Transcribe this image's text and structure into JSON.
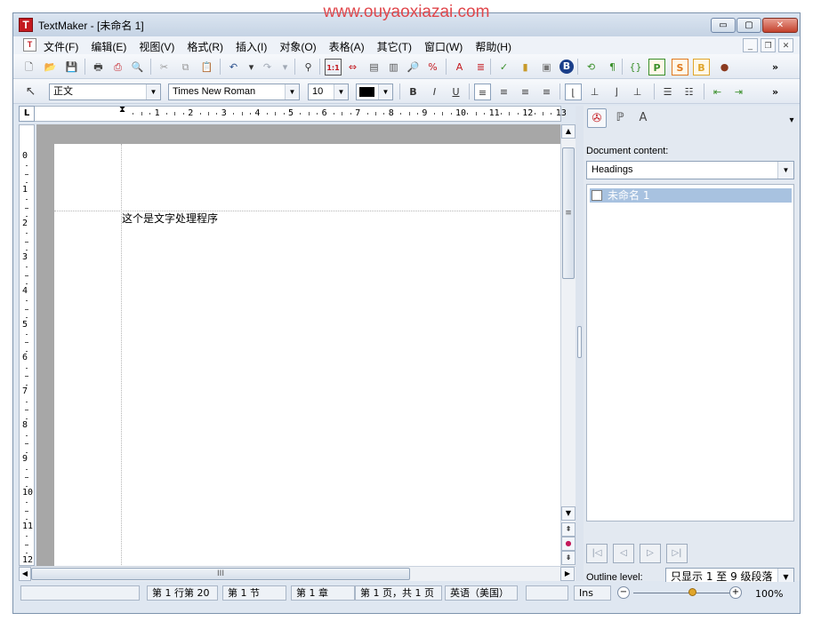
{
  "watermark": "www.ouyaoxiazai.com",
  "window": {
    "title": "TextMaker - [未命名 1]",
    "app_icon": "T",
    "controls": {
      "minimize": "▭",
      "maximize": "▢",
      "close": "✕"
    }
  },
  "menu": {
    "doc_icon": "T",
    "items": [
      "文件(F)",
      "编辑(E)",
      "视图(V)",
      "格式(R)",
      "插入(I)",
      "对象(O)",
      "表格(A)",
      "其它(T)",
      "窗口(W)",
      "帮助(H)"
    ],
    "mdi": {
      "minimize": "_",
      "restore": "❐",
      "close": "✕"
    }
  },
  "toolbar_standard": {
    "icons": [
      {
        "name": "new-document-icon",
        "glyph": "🗋",
        "color": "#555555"
      },
      {
        "name": "open-folder-icon",
        "glyph": "📂",
        "color": "#d8a12a"
      },
      {
        "name": "save-icon",
        "glyph": "💾",
        "color": "#2f5f9c"
      },
      {
        "name": "print-icon",
        "glyph": "🖶",
        "color": "#444444"
      },
      {
        "name": "export-pdf-icon",
        "glyph": "⎙",
        "color": "#c4191f"
      },
      {
        "name": "print-preview-icon",
        "glyph": "🔍",
        "color": "#555555"
      },
      {
        "name": "cut-icon",
        "glyph": "✂",
        "color": "#999999"
      },
      {
        "name": "copy-icon",
        "glyph": "⧉",
        "color": "#999999"
      },
      {
        "name": "paste-icon",
        "glyph": "📋",
        "color": "#7a5a2a"
      },
      {
        "name": "undo-icon",
        "glyph": "↶",
        "color": "#2a4f8c"
      },
      {
        "name": "undo-dropdown-icon",
        "glyph": "▾",
        "color": "#333333"
      },
      {
        "name": "redo-icon",
        "glyph": "↷",
        "color": "#a0a8b4"
      },
      {
        "name": "redo-dropdown-icon",
        "glyph": "▾",
        "color": "#a0a8b4"
      },
      {
        "name": "find-binoculars-icon",
        "glyph": "⚲",
        "color": "#333333"
      },
      {
        "name": "normal-view-icon",
        "glyph": "1:1",
        "color": "#c4191f"
      },
      {
        "name": "page-width-icon",
        "glyph": "⇔",
        "color": "#c4191f"
      },
      {
        "name": "full-page-icon",
        "glyph": "▤",
        "color": "#555555"
      },
      {
        "name": "two-pages-icon",
        "glyph": "▥",
        "color": "#555555"
      },
      {
        "name": "zoom-icon",
        "glyph": "🔎",
        "color": "#333333"
      },
      {
        "name": "zoom-percent-icon",
        "glyph": "%",
        "color": "#c4191f"
      },
      {
        "name": "text-frame-icon",
        "glyph": "A",
        "color": "#c4191f"
      },
      {
        "name": "insert-field-icon",
        "glyph": "≣",
        "color": "#c4191f"
      },
      {
        "name": "spellcheck-icon",
        "glyph": "✓",
        "color": "#3a8f2a"
      },
      {
        "name": "thesaurus-books-icon",
        "glyph": "▮",
        "color": "#c89a2a"
      },
      {
        "name": "database-icon",
        "glyph": "▣",
        "color": "#777777"
      },
      {
        "name": "bold-style-icon",
        "glyph": "B",
        "color": "#1b3f8a"
      },
      {
        "name": "recalc-icon",
        "glyph": "⟲",
        "color": "#3a8f2a"
      },
      {
        "name": "paragraph-marks-icon",
        "glyph": "¶",
        "color": "#3a8f2a"
      },
      {
        "name": "field-codes-icon",
        "glyph": "{}",
        "color": "#3a8f2a"
      },
      {
        "name": "paragraph-style-icon",
        "glyph": "P",
        "color": "#3a8f2a"
      },
      {
        "name": "char-style-icon",
        "glyph": "S",
        "color": "#e07a1f"
      },
      {
        "name": "object-style-icon",
        "glyph": "B",
        "color": "#e0a52a"
      },
      {
        "name": "plugin-icon",
        "glyph": "●",
        "color": "#8a3a1f"
      }
    ],
    "overflow": "»"
  },
  "toolbar_format": {
    "pointer_icon": "↖",
    "style_value": "正文",
    "font_value": "Times New Roman",
    "size_value": "10",
    "color_value": "#000000",
    "icons": [
      {
        "name": "bold-icon",
        "glyph": "B"
      },
      {
        "name": "italic-icon",
        "glyph": "I"
      },
      {
        "name": "underline-icon",
        "glyph": "U"
      },
      {
        "name": "align-left-icon",
        "glyph": "≡"
      },
      {
        "name": "align-center-icon",
        "glyph": "≡"
      },
      {
        "name": "align-right-icon",
        "glyph": "≡"
      },
      {
        "name": "justify-icon",
        "glyph": "≡"
      },
      {
        "name": "tab-left-icon",
        "glyph": "⌊"
      },
      {
        "name": "tab-center-icon",
        "glyph": "⊥"
      },
      {
        "name": "tab-right-icon",
        "glyph": "⌋"
      },
      {
        "name": "tab-decimal-icon",
        "glyph": "⊥"
      },
      {
        "name": "bullets-icon",
        "glyph": "☰"
      },
      {
        "name": "numbering-icon",
        "glyph": "☷"
      },
      {
        "name": "decrease-indent-icon",
        "glyph": "⇤"
      },
      {
        "name": "increase-indent-icon",
        "glyph": "⇥"
      }
    ],
    "overflow": "»"
  },
  "ruler": {
    "corner": "L",
    "h_numbers": [
      "1",
      "2",
      "3",
      "4",
      "5",
      "6",
      "7",
      "8",
      "9",
      "10",
      "11",
      "12",
      "13"
    ],
    "v_numbers": [
      "0",
      "1",
      "2",
      "3",
      "4",
      "5",
      "6",
      "7",
      "8",
      "9",
      "10",
      "11",
      "12"
    ]
  },
  "document": {
    "text": "这个是文字处理程序"
  },
  "scrollbars": {
    "up": "▲",
    "down": "▼",
    "left": "◀",
    "right": "▶",
    "prev_page": "⇞",
    "browse": "●",
    "next_page": "⇟",
    "grip_v": "≡",
    "grip_h": "III"
  },
  "sidebar": {
    "tabs": [
      {
        "name": "navigator-tab-icon",
        "glyph": "✇"
      },
      {
        "name": "styles-tab-icon",
        "glyph": "ℙ"
      },
      {
        "name": "character-tab-icon",
        "glyph": "A"
      }
    ],
    "menu_arrow": "▾",
    "content_label": "Document content:",
    "content_select": "Headings",
    "tree_items": [
      "未命名 1"
    ],
    "nav_buttons": [
      "|◁",
      "◁",
      "▷",
      "▷|"
    ],
    "outline_label": "Outline level:",
    "outline_select": "只显示 1 至 9 级段落"
  },
  "status": {
    "field0": "",
    "position": "第 1 行第 20",
    "section": "第 1 节",
    "chapter": "第 1 章",
    "page": "第 1 页，共 1 页",
    "language": "英语（美国）",
    "blank": "",
    "mode": "Ins",
    "zoom_minus": "−",
    "zoom_plus": "+",
    "zoom_level": 100,
    "zoom_text": "100%"
  }
}
